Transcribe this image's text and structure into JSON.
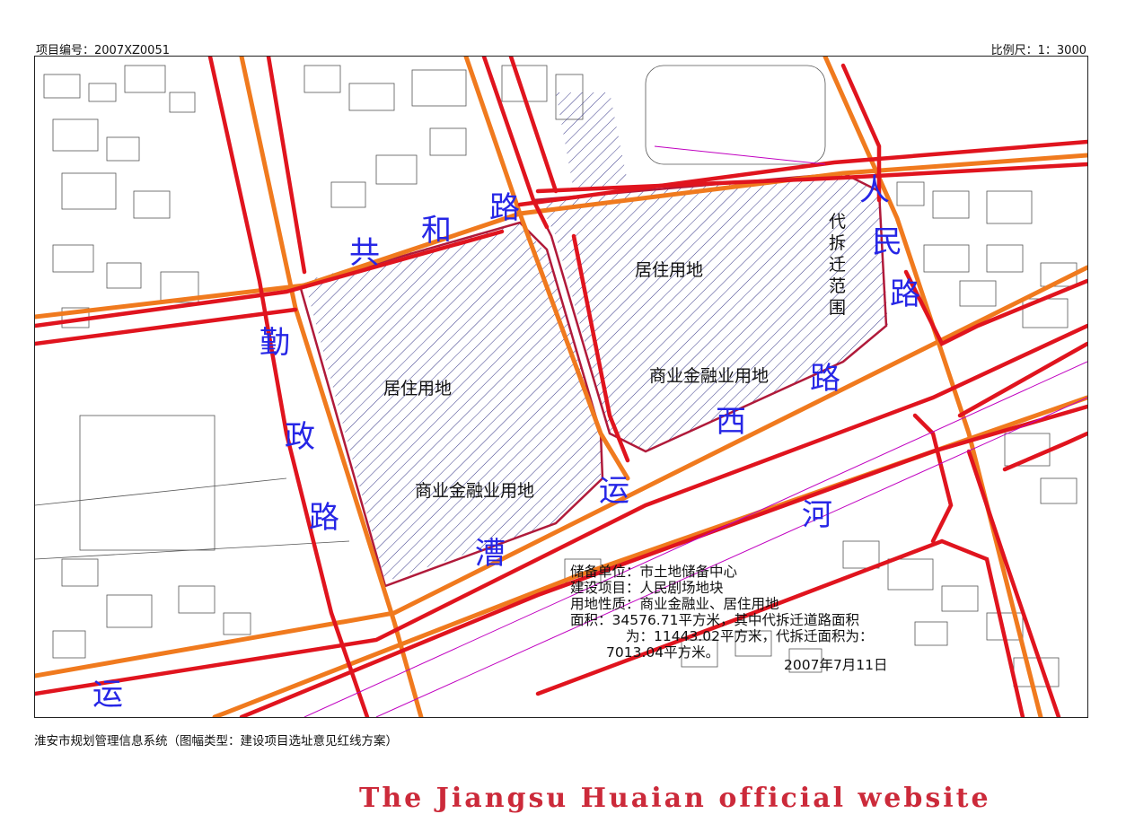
{
  "header": {
    "project_no": "项目编号：2007XZ0051",
    "scale": "比例尺：1：3000"
  },
  "map": {
    "street_chars": {
      "gonghe": [
        "共",
        "和",
        "路"
      ],
      "renmin": [
        "人",
        "民",
        "路"
      ],
      "qinzheng": [
        "勤",
        "政",
        "路"
      ],
      "caoyun": [
        "运",
        "漕"
      ],
      "xiyun": [
        "路",
        "西",
        "运",
        "河"
      ],
      "corner": "运"
    },
    "land_use": {
      "residential_upper": "居住用地",
      "residential_lower": "居住用地",
      "commercial_upper": "商业金融业用地",
      "commercial_lower": "商业金融业用地"
    },
    "demolition_note": [
      "代",
      "拆",
      "迁",
      "范",
      "围"
    ],
    "info": {
      "unit": "储备单位：市土地储备中心",
      "project": "建设项目：人民剧场地块",
      "nature": "用地性质：商业金融业、居住用地",
      "area1": "面积：34576.71平方米，其中代拆迁道路面积",
      "area2": "为：11443.02平方米，代拆迁面积为：",
      "area3": "7013.04平方米。",
      "date": "2007年7月11日"
    },
    "colors": {
      "road_red": "#e0141e",
      "road_orange": "#f07a1e",
      "parcel_outline": "#b01a3a",
      "hatch": "#3a3a8a",
      "street_text": "#2626e6",
      "base_lines": "#555555"
    }
  },
  "footer": {
    "system": "淮安市规划管理信息系统（图幅类型：建设项目选址意见红线方案）",
    "banner": "The Jiangsu Huaian official website"
  }
}
